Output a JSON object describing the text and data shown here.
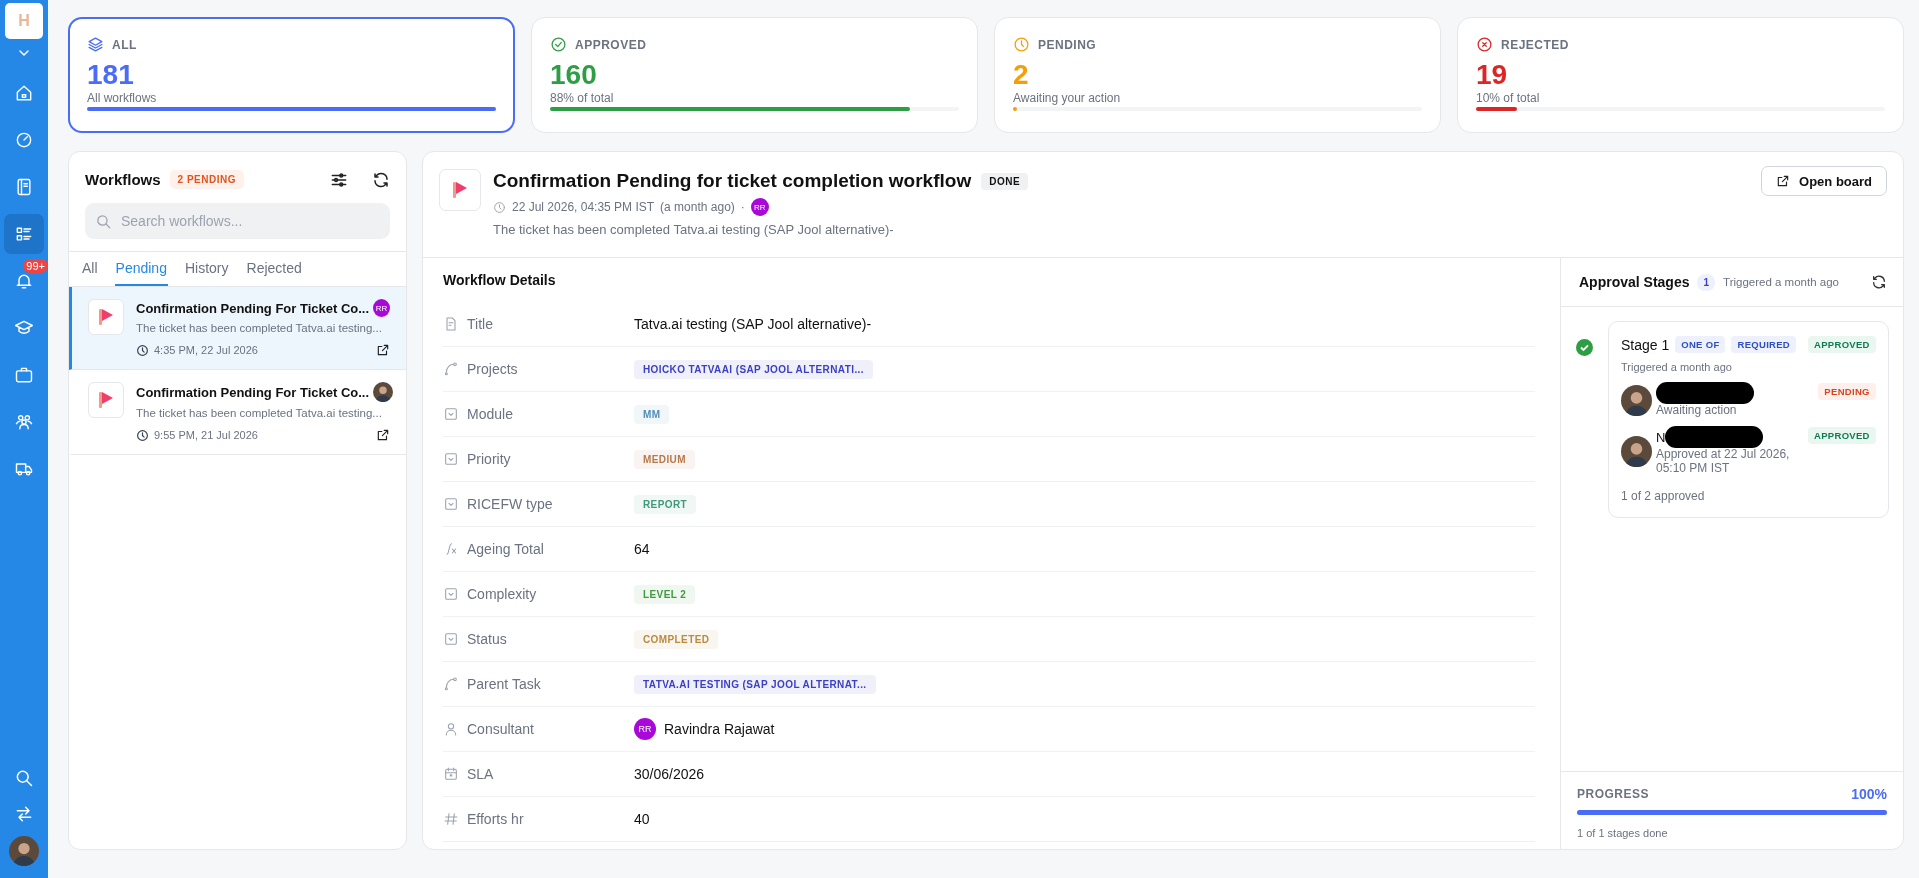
{
  "sidebar": {
    "logo": "H",
    "items": [
      {
        "kind": "home",
        "selected": false
      },
      {
        "kind": "gauge",
        "selected": false
      },
      {
        "kind": "book",
        "selected": false
      },
      {
        "kind": "list",
        "selected": true
      },
      {
        "kind": "bell",
        "selected": false,
        "badge": "99+"
      },
      {
        "kind": "cap",
        "selected": false
      },
      {
        "kind": "briefcase",
        "selected": false
      },
      {
        "kind": "users",
        "selected": false
      },
      {
        "kind": "truck",
        "selected": false
      }
    ],
    "bottom": [
      {
        "kind": "search"
      },
      {
        "kind": "swap"
      },
      {
        "kind": "avatar"
      }
    ]
  },
  "stats": [
    {
      "kind": "layers",
      "label": "ALL",
      "value": "181",
      "caption": "All workflows",
      "level": 1,
      "color": "#4a6cf7",
      "selected": true
    },
    {
      "kind": "check",
      "label": "APPROVED",
      "value": "160",
      "caption": "88% of total",
      "level": 0.88,
      "color": "#2e9e44",
      "selected": false
    },
    {
      "kind": "clock",
      "label": "PENDING",
      "value": "2",
      "caption": "Awaiting your action",
      "level": 0.01,
      "color": "#f59e0b",
      "selected": false
    },
    {
      "kind": "x",
      "label": "REJECTED",
      "value": "19",
      "caption": "10% of total",
      "level": 0.1,
      "color": "#dc2626",
      "selected": false
    }
  ],
  "workflows": {
    "title": "Workflows",
    "badge": "2 PENDING",
    "search": {
      "placeholder": "Search workflows..."
    },
    "tabs": [
      {
        "label": "All",
        "selected": false
      },
      {
        "label": "Pending",
        "selected": true
      },
      {
        "label": "History",
        "selected": false
      },
      {
        "label": "Rejected",
        "selected": false
      }
    ],
    "items": [
      {
        "title": "Confirmation Pending For Ticket Co...",
        "description": "The ticket has been completed Tatva.ai testing...",
        "time": "4:35 PM, 22 Jul 2026",
        "avatar": {
          "kind": "initials",
          "text": "RR"
        },
        "selected": true
      },
      {
        "title": "Confirmation Pending For Ticket Co...",
        "description": "The ticket has been completed Tatva.ai testing...",
        "time": "9:55 PM, 21 Jul 2026",
        "avatar": {
          "kind": "photo"
        },
        "selected": false
      }
    ]
  },
  "detail": {
    "title": "Confirmation Pending for ticket completion workflow",
    "status": "DONE",
    "date": "22 Jul 2026, 04:35 PM IST",
    "relative": "(a month ago)",
    "separator": "·",
    "avatar": "RR",
    "description": "The ticket has been completed Tatva.ai testing (SAP Jool alternative)-",
    "open_button": "Open board",
    "section_title": "Workflow Details",
    "fields": [
      {
        "label": "Title",
        "kind": "text",
        "value": "Tatva.ai testing (SAP Jool alternative)-"
      },
      {
        "label": "Projects",
        "kind": "tag",
        "value": "HOICKO TATVAAI (SAP JOOL ALTERNATI...",
        "color": "#3b3fc4"
      },
      {
        "label": "Module",
        "kind": "tag",
        "value": "MM",
        "color": "#4f8fb8"
      },
      {
        "label": "Priority",
        "kind": "tag",
        "value": "MEDIUM",
        "color": "#b7794a"
      },
      {
        "label": "RICEFW type",
        "kind": "tag",
        "value": "REPORT",
        "color": "#3f9a7a"
      },
      {
        "label": "Ageing Total",
        "kind": "text",
        "value": "64"
      },
      {
        "label": "Complexity",
        "kind": "tag",
        "value": "LEVEL 2",
        "color": "#3f9a3f"
      },
      {
        "label": "Status",
        "kind": "tag",
        "value": "COMPLETED",
        "color": "#b98a40"
      },
      {
        "label": "Parent Task",
        "kind": "tag",
        "value": "TATVA.AI TESTING (SAP JOOL ALTERNAT...",
        "color": "#3b3fc4"
      },
      {
        "label": "Consultant",
        "kind": "person",
        "value": "Ravindra Rajawat",
        "initials": "RR"
      },
      {
        "label": "SLA",
        "kind": "text",
        "value": "30/06/2026"
      },
      {
        "label": "Efforts hr",
        "kind": "text",
        "value": "40"
      }
    ]
  },
  "approval": {
    "title": "Approval Stages",
    "count": "1",
    "triggered": "Triggered a month ago",
    "stages": [
      {
        "name": "Stage 1",
        "tags": [
          "ONE OF",
          "REQUIRED"
        ],
        "status": "APPROVED",
        "done": true,
        "triggered": "Triggered a month ago",
        "summary": "1 of 2 approved",
        "approvers": [
          {
            "redacted": true,
            "note": "Awaiting action",
            "status": "PENDING",
            "kind": "pending"
          },
          {
            "name": "N",
            "redacted": true,
            "note": "Approved at 22 Jul 2026, 05:10 PM IST",
            "status": "APPROVED",
            "kind": "approved"
          }
        ]
      }
    ],
    "progress": {
      "label": "PROGRESS",
      "value": "100%",
      "level": 1,
      "caption": "1 of 1 stages done"
    }
  }
}
